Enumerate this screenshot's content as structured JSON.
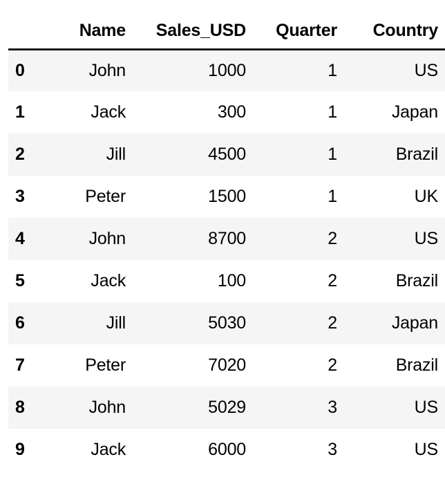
{
  "table": {
    "index_header": "",
    "columns": [
      "Name",
      "Sales_USD",
      "Quarter",
      "Country"
    ],
    "index": [
      "0",
      "1",
      "2",
      "3",
      "4",
      "5",
      "6",
      "7",
      "8",
      "9"
    ],
    "rows": [
      {
        "name": "John",
        "sales_usd": "1000",
        "quarter": "1",
        "country": "US"
      },
      {
        "name": "Jack",
        "sales_usd": "300",
        "quarter": "1",
        "country": "Japan"
      },
      {
        "name": "Jill",
        "sales_usd": "4500",
        "quarter": "1",
        "country": "Brazil"
      },
      {
        "name": "Peter",
        "sales_usd": "1500",
        "quarter": "1",
        "country": "UK"
      },
      {
        "name": "John",
        "sales_usd": "8700",
        "quarter": "2",
        "country": "US"
      },
      {
        "name": "Jack",
        "sales_usd": "100",
        "quarter": "2",
        "country": "Brazil"
      },
      {
        "name": "Jill",
        "sales_usd": "5030",
        "quarter": "2",
        "country": "Japan"
      },
      {
        "name": "Peter",
        "sales_usd": "7020",
        "quarter": "2",
        "country": "Brazil"
      },
      {
        "name": "John",
        "sales_usd": "5029",
        "quarter": "3",
        "country": "US"
      },
      {
        "name": "Jack",
        "sales_usd": "6000",
        "quarter": "3",
        "country": "US"
      }
    ]
  },
  "style": {
    "stripe_color": "#f5f5f5",
    "background_color": "#ffffff",
    "text_color": "#000000",
    "header_rule_color": "#1a1a1a"
  }
}
